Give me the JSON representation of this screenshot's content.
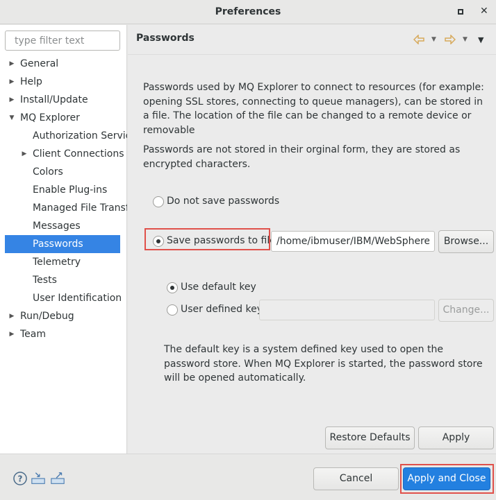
{
  "window": {
    "title": "Preferences"
  },
  "sidebar": {
    "filter_placeholder": "type filter text",
    "items": [
      {
        "label": "General",
        "level": 0,
        "twisty": "collapsed"
      },
      {
        "label": "Help",
        "level": 0,
        "twisty": "collapsed"
      },
      {
        "label": "Install/Update",
        "level": 0,
        "twisty": "collapsed"
      },
      {
        "label": "MQ Explorer",
        "level": 0,
        "twisty": "expanded"
      },
      {
        "label": "Authorization Servic",
        "level": 1,
        "twisty": "none"
      },
      {
        "label": "Client Connections",
        "level": 1,
        "twisty": "collapsed"
      },
      {
        "label": "Colors",
        "level": 1,
        "twisty": "none"
      },
      {
        "label": "Enable Plug-ins",
        "level": 1,
        "twisty": "none"
      },
      {
        "label": "Managed File Transf",
        "level": 1,
        "twisty": "none"
      },
      {
        "label": "Messages",
        "level": 1,
        "twisty": "none"
      },
      {
        "label": "Passwords",
        "level": 1,
        "twisty": "none",
        "selected": true
      },
      {
        "label": "Telemetry",
        "level": 1,
        "twisty": "none"
      },
      {
        "label": "Tests",
        "level": 1,
        "twisty": "none"
      },
      {
        "label": "User Identification",
        "level": 1,
        "twisty": "none"
      },
      {
        "label": "Run/Debug",
        "level": 0,
        "twisty": "collapsed"
      },
      {
        "label": "Team",
        "level": 0,
        "twisty": "collapsed"
      }
    ]
  },
  "page": {
    "title": "Passwords",
    "intro": "Passwords used by MQ Explorer to connect to resources (for example: opening SSL stores, connecting to queue managers), can be stored in a file. The location of the file can be changed to a remote device or removable",
    "encryption_note": "Passwords are not stored in their orginal form, they are stored as encrypted characters.",
    "option_do_not_save": "Do not save passwords",
    "option_save_to_file": "Save passwords to file",
    "file_path_value": "/home/ibmuser/IBM/WebSphereMQ",
    "browse_label": "Browse...",
    "key_default": "Use default key",
    "key_user_defined": "User defined key",
    "user_key_value": "",
    "change_label": "Change...",
    "default_key_note": "The default key is a system defined key used to open the password store. When MQ Explorer is started, the password store will be opened automatically.",
    "restore_defaults_label": "Restore Defaults",
    "apply_label": "Apply"
  },
  "footer": {
    "cancel_label": "Cancel",
    "apply_close_label": "Apply and Close"
  },
  "colors": {
    "selection": "#3584e4",
    "highlight_box": "#e0504a",
    "primary_button": "#2380e0",
    "nav_arrow": "#d7a95b"
  },
  "icons": [
    "maximize-icon",
    "close-icon",
    "back-arrow-icon",
    "forward-arrow-icon",
    "view-menu-icon",
    "help-icon",
    "import-icon",
    "export-icon"
  ]
}
